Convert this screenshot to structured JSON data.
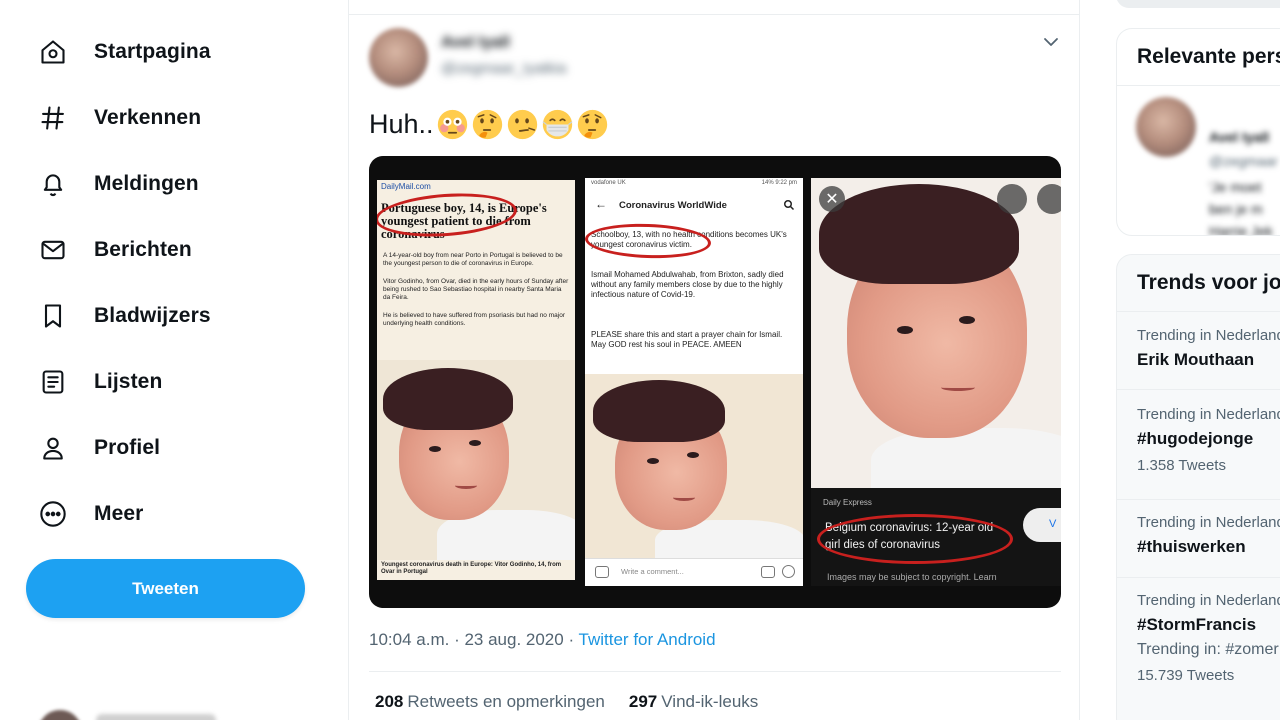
{
  "nav": {
    "items": [
      {
        "label": "Startpagina",
        "icon": "home-icon"
      },
      {
        "label": "Verkennen",
        "icon": "hashtag-icon"
      },
      {
        "label": "Meldingen",
        "icon": "bell-icon"
      },
      {
        "label": "Berichten",
        "icon": "mail-icon"
      },
      {
        "label": "Bladwijzers",
        "icon": "bookmark-icon"
      },
      {
        "label": "Lijsten",
        "icon": "list-icon"
      },
      {
        "label": "Profiel",
        "icon": "person-icon"
      },
      {
        "label": "Meer",
        "icon": "more-circle-icon"
      }
    ],
    "tweet_button": "Tweeten"
  },
  "tweet": {
    "author_name": "Avel Iyall",
    "author_handle": "@zegmaar_Iyatkia",
    "text": "Huh..",
    "emojis": [
      "flushed-face",
      "thinking-face",
      "face-with-open-mouth",
      "face-with-medical-mask",
      "thinking-face"
    ],
    "media": {
      "panel1": {
        "source": "DailyMail.com",
        "headline": "Portuguese boy, 14, is Europe's youngest patient to die from coronavirus",
        "p1": "A 14-year-old boy from near Porto in Portugal is believed to be the youngest person to die of coronavirus in Europe.",
        "p2": "Vitor Godinho, from Ovar, died in the early hours of Sunday after being rushed to Sao Sebastiao hospital in nearby Santa Maria da Feira.",
        "p3": "He is believed to have suffered from psoriasis but had no major underlying health conditions.",
        "caption": "Youngest coronavirus death in Europe: Vitor Godinho, 14, from Ovar in Portugal"
      },
      "panel2": {
        "status_left": "vodafone UK",
        "status_right": "14% 9:22 pm",
        "title": "Coronavirus WorldWide",
        "p1": "Schoolboy, 13, with no health conditions becomes UK's youngest coronavirus victim.",
        "p2": "Ismail Mohamed Abdulwahab, from Brixton, sadly died without any family members close by due to the highly infectious nature of Covid-19.",
        "p3": "PLEASE share this and start a prayer chain for Ismail. May GOD rest his soul in PEACE. AMEEN",
        "comment_placeholder": "Write a comment..."
      },
      "panel3": {
        "source": "Daily Express",
        "headline": "Belgium coronavirus: 12-year old girl dies of coronavirus",
        "copyright": "Images may be subject to copyright. Learn",
        "visit": "V"
      }
    },
    "time": "10:04 a.m.",
    "date": "23 aug. 2020",
    "source": "Twitter for Android",
    "retweets_count": "208",
    "retweets_label": "Retweets en opmerkingen",
    "likes_count": "297",
    "likes_label": "Vind-ik-leuks"
  },
  "relevant": {
    "title": "Relevante personen",
    "person_name": "Avel Iyall",
    "person_handle": "@zegmaar",
    "bio_1": "'Je moet",
    "bio_2": "ben je m",
    "bio_3": "Harrie Jek"
  },
  "trends": {
    "title": "Trends voor jou",
    "items": [
      {
        "context": "Trending in Nederland",
        "name": "Erik Mouthaan",
        "sub": "",
        "count": ""
      },
      {
        "context": "Trending in Nederland",
        "name": "#hugodejonge",
        "sub": "",
        "count": "1.358 Tweets"
      },
      {
        "context": "Trending in Nederland",
        "name": "#thuiswerken",
        "sub": "",
        "count": ""
      },
      {
        "context": "Trending in Nederland",
        "name": "#StormFrancis",
        "sub": "Trending in: #zomer",
        "count": "15.739 Tweets"
      }
    ]
  },
  "colors": {
    "accent": "#1da1f2",
    "link": "#1b95e0",
    "text": "#0f1419",
    "muted": "#536471",
    "highlight_red": "#c8201e"
  }
}
